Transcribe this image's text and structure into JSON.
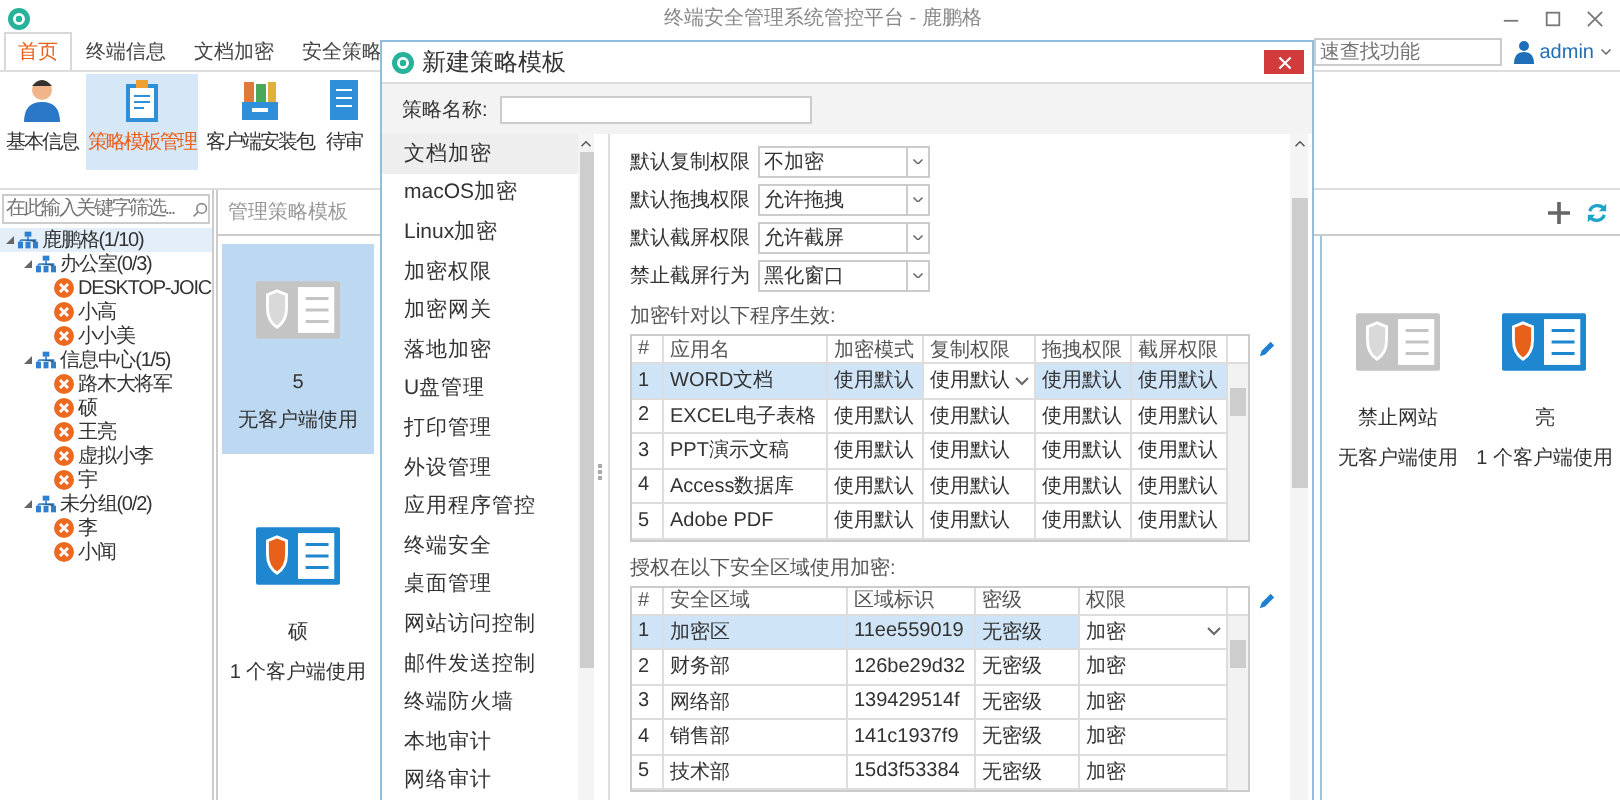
{
  "window": {
    "title": "终端安全管理系统管控平台 - 鹿鹏格"
  },
  "ribbon_tabs": [
    {
      "label": "首页",
      "selected": true
    },
    {
      "label": "终端信息",
      "selected": false
    },
    {
      "label": "文档加密",
      "selected": false
    },
    {
      "label": "安全策略",
      "selected": false
    }
  ],
  "quick_search": {
    "placeholder": "速查找功能"
  },
  "user": {
    "name": "admin"
  },
  "ribbon_buttons": [
    {
      "label": "基本信息",
      "selected": false
    },
    {
      "label": "策略模板管理",
      "selected": true
    },
    {
      "label": "客户端安装包",
      "selected": false
    },
    {
      "label": "待审",
      "selected": false
    }
  ],
  "tree_search": {
    "placeholder": "在此输入关键字筛选..."
  },
  "tree": [
    {
      "label": "鹿鹏格(1/10)",
      "kind": "group",
      "expanded": true,
      "selected": true,
      "children": [
        {
          "label": "办公室(0/3)",
          "kind": "group",
          "expanded": true,
          "selected": false,
          "children": [
            {
              "label": "DESKTOP-JOIC",
              "kind": "client",
              "selected": false
            },
            {
              "label": "小高",
              "kind": "client",
              "selected": false
            },
            {
              "label": "小小美",
              "kind": "client",
              "selected": false
            }
          ]
        },
        {
          "label": "信息中心(1/5)",
          "kind": "group",
          "expanded": true,
          "selected": false,
          "children": [
            {
              "label": "路木大将军",
              "kind": "client",
              "selected": false
            },
            {
              "label": "硕",
              "kind": "client",
              "selected": false
            },
            {
              "label": "王亮",
              "kind": "client",
              "selected": false
            },
            {
              "label": "虚拟小李",
              "kind": "client",
              "selected": false
            },
            {
              "label": "宇",
              "kind": "client",
              "selected": false
            }
          ]
        },
        {
          "label": "未分组(0/2)",
          "kind": "group",
          "expanded": true,
          "selected": false,
          "children": [
            {
              "label": "李",
              "kind": "client",
              "selected": false
            },
            {
              "label": "小闻",
              "kind": "client",
              "selected": false
            }
          ]
        }
      ]
    }
  ],
  "policy_panel": {
    "title": "管理策略模板"
  },
  "policy_cards_left": [
    {
      "title": "5",
      "subtitle": "无客户端使用",
      "active": false,
      "selected": true
    },
    {
      "title": "硕",
      "subtitle": "1 个客户端使用",
      "active": true,
      "selected": false
    }
  ],
  "policy_cards_right": [
    {
      "title": "禁止网站",
      "subtitle": "无客户端使用",
      "active": false,
      "selected": false
    },
    {
      "title": "亮",
      "subtitle": "1 个客户端使用",
      "active": true,
      "selected": false
    }
  ],
  "dialog": {
    "title": "新建策略模板",
    "name_label": "策略名称:",
    "categories": [
      {
        "label": "文档加密",
        "selected": true
      },
      {
        "label": "macOS加密",
        "selected": false
      },
      {
        "label": "Linux加密",
        "selected": false
      },
      {
        "label": "加密权限",
        "selected": false
      },
      {
        "label": "加密网关",
        "selected": false
      },
      {
        "label": "落地加密",
        "selected": false
      },
      {
        "label": "U盘管理",
        "selected": false
      },
      {
        "label": "打印管理",
        "selected": false
      },
      {
        "label": "外设管理",
        "selected": false
      },
      {
        "label": "应用程序管控",
        "selected": false
      },
      {
        "label": "终端安全",
        "selected": false
      },
      {
        "label": "桌面管理",
        "selected": false
      },
      {
        "label": "网站访问控制",
        "selected": false
      },
      {
        "label": "邮件发送控制",
        "selected": false
      },
      {
        "label": "终端防火墙",
        "selected": false
      },
      {
        "label": "本地审计",
        "selected": false
      },
      {
        "label": "网络审计",
        "selected": false
      }
    ],
    "settings": [
      {
        "label": "默认复制权限",
        "value": "不加密"
      },
      {
        "label": "默认拖拽权限",
        "value": "允许拖拽"
      },
      {
        "label": "默认截屏权限",
        "value": "允许截屏"
      },
      {
        "label": "禁止截屏行为",
        "value": "黑化窗口"
      }
    ],
    "apps_table": {
      "caption": "加密针对以下程序生效:",
      "columns": [
        {
          "label": "#",
          "dropdown": false
        },
        {
          "label": "应用名",
          "dropdown": false
        },
        {
          "label": "加密模式",
          "dropdown": false
        },
        {
          "label": "复制权限",
          "dropdown": true
        },
        {
          "label": "拖拽权限",
          "dropdown": false
        },
        {
          "label": "截屏权限",
          "dropdown": false
        }
      ],
      "rows": [
        {
          "cells": [
            "1",
            "WORD文档",
            "使用默认",
            "使用默认",
            "使用默认",
            "使用默认"
          ],
          "selected": true
        },
        {
          "cells": [
            "2",
            "EXCEL电子表格",
            "使用默认",
            "使用默认",
            "使用默认",
            "使用默认"
          ],
          "selected": false
        },
        {
          "cells": [
            "3",
            "PPT演示文稿",
            "使用默认",
            "使用默认",
            "使用默认",
            "使用默认"
          ],
          "selected": false
        },
        {
          "cells": [
            "4",
            "Access数据库",
            "使用默认",
            "使用默认",
            "使用默认",
            "使用默认"
          ],
          "selected": false
        },
        {
          "cells": [
            "5",
            "Adobe PDF",
            "使用默认",
            "使用默认",
            "使用默认",
            "使用默认"
          ],
          "selected": false
        }
      ]
    },
    "zones_table": {
      "caption": "授权在以下安全区域使用加密:",
      "columns": [
        {
          "label": "#",
          "dropdown": false
        },
        {
          "label": "安全区域",
          "dropdown": false
        },
        {
          "label": "区域标识",
          "dropdown": false
        },
        {
          "label": "密级",
          "dropdown": false
        },
        {
          "label": "权限",
          "dropdown": true
        }
      ],
      "rows": [
        {
          "cells": [
            "1",
            "加密区",
            "11ee559019",
            "无密级",
            "加密"
          ],
          "selected": true
        },
        {
          "cells": [
            "2",
            "财务部",
            "126be29d32",
            "无密级",
            "加密"
          ],
          "selected": false
        },
        {
          "cells": [
            "3",
            "网络部",
            "139429514f",
            "无密级",
            "加密"
          ],
          "selected": false
        },
        {
          "cells": [
            "4",
            "销售部",
            "141c1937f9",
            "无密级",
            "加密"
          ],
          "selected": false
        },
        {
          "cells": [
            "5",
            "技术部",
            "15d3f53384",
            "无密级",
            "加密"
          ],
          "selected": false
        }
      ]
    }
  }
}
